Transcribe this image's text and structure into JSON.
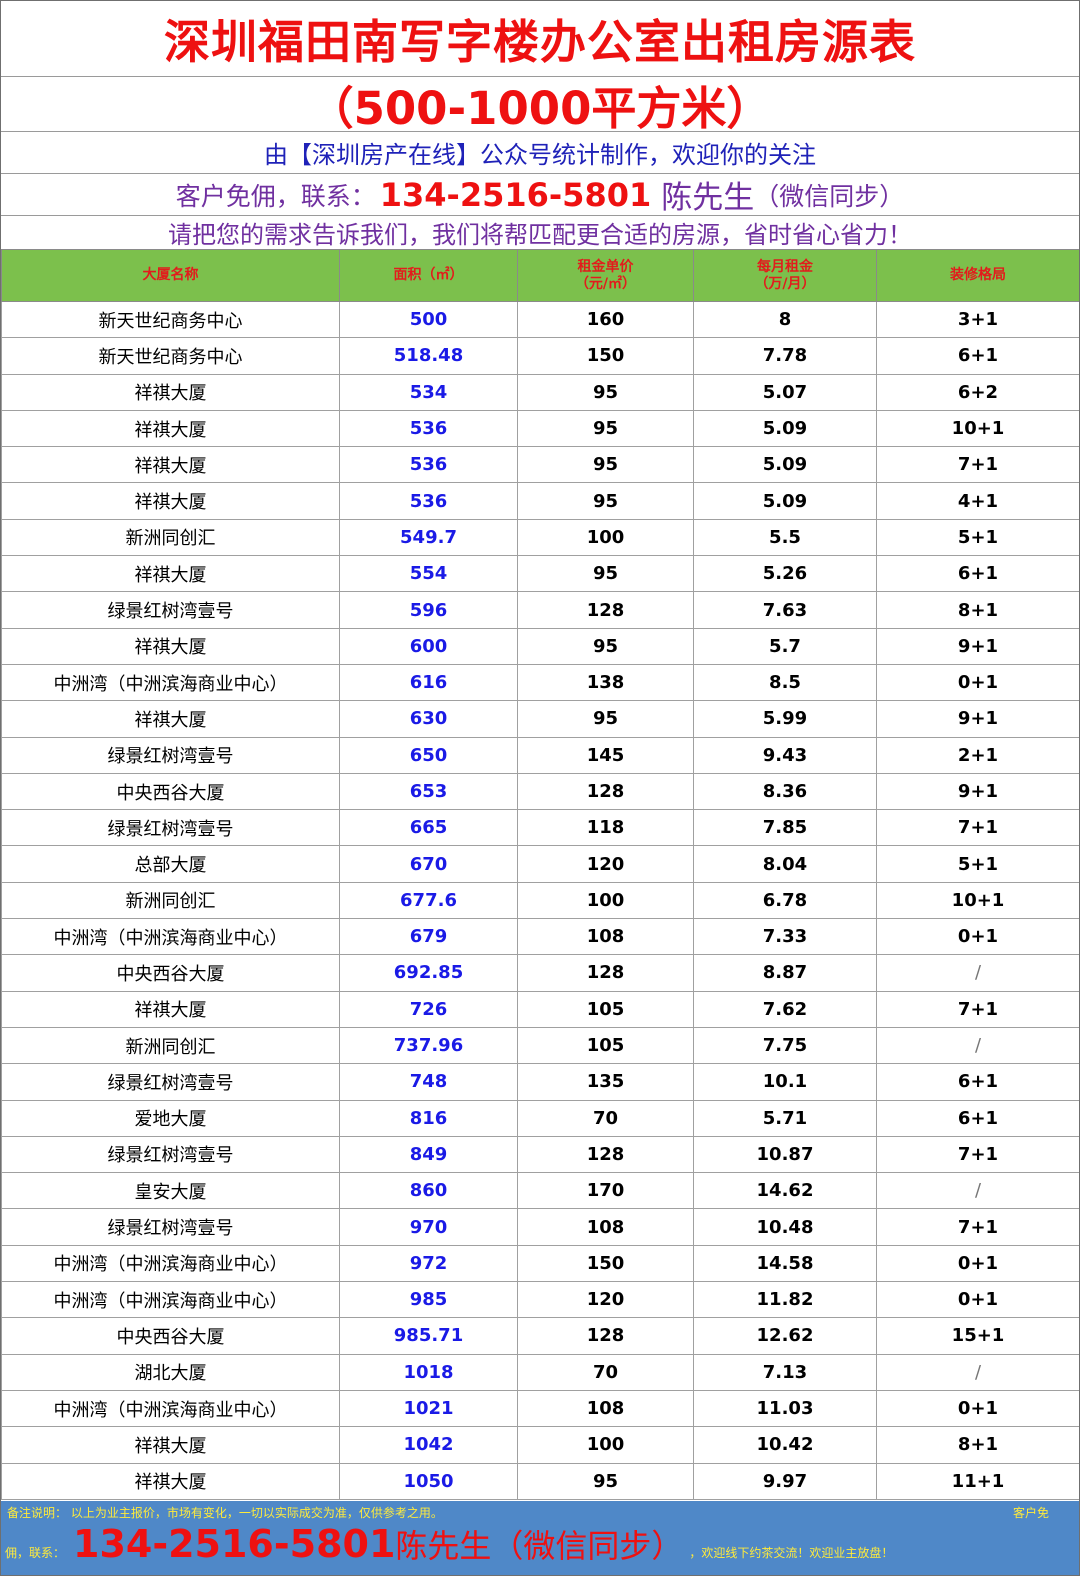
{
  "title": "深圳福田南写字楼办公室出租房源表",
  "subtitle": "（500-1000平方米）",
  "line3": "由【深圳房产在线】公众号统计制作，欢迎你的关注",
  "contact": {
    "label": "客户免佣，联系：",
    "phone": "134-2516-5801",
    "name": "陈先生",
    "wechat": "（微信同步）"
  },
  "line5": "请把您的需求告诉我们，我们将帮匹配更合适的房源，省时省心省力！",
  "table": {
    "headers": [
      {
        "line1": "大厦名称",
        "line2": ""
      },
      {
        "line1": "面积（㎡）",
        "line2": ""
      },
      {
        "line1": "租金单价",
        "line2": "（元/㎡）"
      },
      {
        "line1": "每月租金",
        "line2": "（万/月）"
      },
      {
        "line1": "装修格局",
        "line2": ""
      }
    ],
    "rows": [
      [
        "新天世纪商务中心",
        "500",
        "160",
        "8",
        "3+1"
      ],
      [
        "新天世纪商务中心",
        "518.48",
        "150",
        "7.78",
        "6+1"
      ],
      [
        "祥祺大厦",
        "534",
        "95",
        "5.07",
        "6+2"
      ],
      [
        "祥祺大厦",
        "536",
        "95",
        "5.09",
        "10+1"
      ],
      [
        "祥祺大厦",
        "536",
        "95",
        "5.09",
        "7+1"
      ],
      [
        "祥祺大厦",
        "536",
        "95",
        "5.09",
        "4+1"
      ],
      [
        "新洲同创汇",
        "549.7",
        "100",
        "5.5",
        "5+1"
      ],
      [
        "祥祺大厦",
        "554",
        "95",
        "5.26",
        "6+1"
      ],
      [
        "绿景红树湾壹号",
        "596",
        "128",
        "7.63",
        "8+1"
      ],
      [
        "祥祺大厦",
        "600",
        "95",
        "5.7",
        "9+1"
      ],
      [
        "中洲湾（中洲滨海商业中心）",
        "616",
        "138",
        "8.5",
        "0+1"
      ],
      [
        "祥祺大厦",
        "630",
        "95",
        "5.99",
        "9+1"
      ],
      [
        "绿景红树湾壹号",
        "650",
        "145",
        "9.43",
        "2+1"
      ],
      [
        "中央西谷大厦",
        "653",
        "128",
        "8.36",
        "9+1"
      ],
      [
        "绿景红树湾壹号",
        "665",
        "118",
        "7.85",
        "7+1"
      ],
      [
        "总部大厦",
        "670",
        "120",
        "8.04",
        "5+1"
      ],
      [
        "新洲同创汇",
        "677.6",
        "100",
        "6.78",
        "10+1"
      ],
      [
        "中洲湾（中洲滨海商业中心）",
        "679",
        "108",
        "7.33",
        "0+1"
      ],
      [
        "中央西谷大厦",
        "692.85",
        "128",
        "8.87",
        "/"
      ],
      [
        "祥祺大厦",
        "726",
        "105",
        "7.62",
        "7+1"
      ],
      [
        "新洲同创汇",
        "737.96",
        "105",
        "7.75",
        "/"
      ],
      [
        "绿景红树湾壹号",
        "748",
        "135",
        "10.1",
        "6+1"
      ],
      [
        "爱地大厦",
        "816",
        "70",
        "5.71",
        "6+1"
      ],
      [
        "绿景红树湾壹号",
        "849",
        "128",
        "10.87",
        "7+1"
      ],
      [
        "皇安大厦",
        "860",
        "170",
        "14.62",
        "/"
      ],
      [
        "绿景红树湾壹号",
        "970",
        "108",
        "10.48",
        "7+1"
      ],
      [
        "中洲湾（中洲滨海商业中心）",
        "972",
        "150",
        "14.58",
        "0+1"
      ],
      [
        "中洲湾（中洲滨海商业中心）",
        "985",
        "120",
        "11.82",
        "0+1"
      ],
      [
        "中央西谷大厦",
        "985.71",
        "128",
        "12.62",
        "15+1"
      ],
      [
        "湖北大厦",
        "1018",
        "70",
        "7.13",
        "/"
      ],
      [
        "中洲湾（中洲滨海商业中心）",
        "1021",
        "108",
        "11.03",
        "0+1"
      ],
      [
        "祥祺大厦",
        "1042",
        "100",
        "10.42",
        "8+1"
      ],
      [
        "祥祺大厦",
        "1050",
        "95",
        "9.97",
        "11+1"
      ]
    ]
  },
  "footer": {
    "note": "备注说明：   以上为业主报价，市场有变化，一切以实际成交为准，仅供参考之用。",
    "note_right": "客户免",
    "prefix": "佣，联系：",
    "phone": "134-2516-5801",
    "name": "陈先生（微信同步）",
    "suffix": "，欢迎线下约茶交流！欢迎业主放盘！"
  },
  "colors": {
    "title_red": "#ee1111",
    "blue_text": "#1f22b8",
    "purple_text": "#7030a0",
    "header_green": "#7cc04c",
    "area_blue": "#1a1ae6",
    "footer_blue": "#4f88c8",
    "footer_yellow": "#ffeb3b"
  }
}
